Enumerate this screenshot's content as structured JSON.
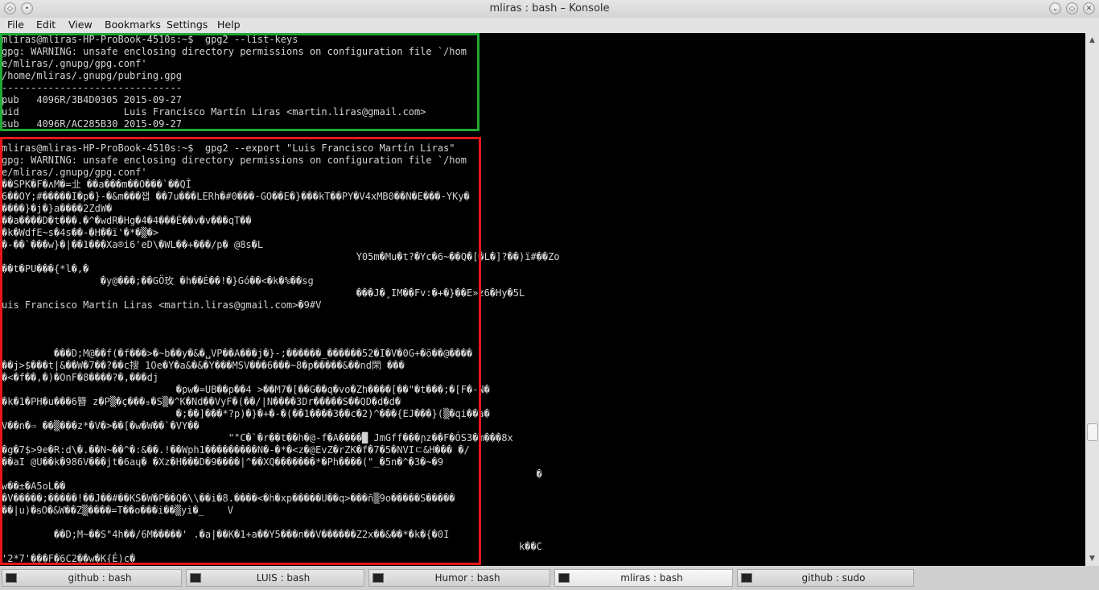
{
  "window": {
    "title": "mliras : bash – Konsole"
  },
  "menu": {
    "items": [
      "File",
      "Edit",
      "View",
      "Bookmarks",
      "Settings",
      "Help"
    ]
  },
  "terminal": {
    "lines": [
      "mliras@mliras-HP-ProBook-4510s:~$  gpg2 --list-keys",
      "gpg: WARNING: unsafe enclosing directory permissions on configuration file `/hom",
      "e/mliras/.gnupg/gpg.conf'",
      "/home/mliras/.gnupg/pubring.gpg",
      "-------------------------------",
      "pub   4096R/3B4D0305 2015-09-27",
      "uid                  Luis Francisco Martín Liras <martin.liras@gmail.com>",
      "sub   4096R/AC285B30 2015-09-27",
      "",
      "mliras@mliras-HP-ProBook-4510s:~$  gpg2 --export \"Luis Francisco Martín Liras\"",
      "gpg: WARNING: unsafe enclosing directory permissions on configuration file `/hom",
      "e/mliras/.gnupg/gpg.conf'",
      "��SPK�F�ʌM�=㐀 ��a���m��O���`��QÎ",
      "6��OY;#�����I�p�}-�&m���잽 ��7u���LERh�#0���-GO��E�}���kT��PY�V4xMB0��N�E���-YKy�",
      "����}�j�}a����2ZdW�",
      "��a����D�t���.�^�wdR�Hg�4�4���É��v�v���qT��",
      "�k�WdfE~s�4s��-�H��ï'�*�▒�>",
      "�-��`���w}�|��1���Xa®i6'eD\\�WL��+���/p� @8s�L",
      "                                                             Y05m�Mu�t?�Yc�6~��Q�[�L�]?��)ï#��Zo",
      "��t�PU���{*l�,�",
      "                 �y@���;��GÖ玫 �h��É��!�}Gó��<�k�%��sg",
      "                                                             ���J�¸IM��Fv:�+�}��E»z6�Hy�5L",
      "uis Francisco Martín Liras <martin.liras@gmail.com>�9#V",
      "",
      "",
      "",
      "         ���D;M@��f(�f���>�~b��y�&�␣VP��A���j�}-;������_������52�I�V�0G+�õ��@����",
      "��j>$���t|&��W�7��?��c搜 1Oe�Y�a&�&�Y���MSV���6���~8�p�����&��nd閑 ���",
      "�<�f��,�)�OnF�8����?�,���dj",
      "                              �pw�=UB��p��4 >��M7�[��G��q�vo�Zh����[��\"�t���;�[F�-N�",
      "�k�1�PH�u���6簪 z�P▒�ç���₉�S▒�^K�Nd��VyF�(��/|N����3Dr�����S��QD�d�d�",
      "                              �;��]���*?p)�}�+�-�(��1����3��c�2)^���{EJ���}(▒�qi��a�",
      "V��n�⇨ ��▒���z*�V�>��[�w�W��`�VY��",
      "                                       \"\"C�`�r��t��h�@-f�A����█ JmGff���ɲz��F�ÓS3�m���8x",
      "�g�7$>9e�R:d\\�.��N~��^�:&��.!��Wph1���������N�-�*�<z�@EvZ�rZK�f�7�5�NVIㄷ&H��� �/",
      "��aI @U��k�986V���jt�6aɥ� �Xz�H���D�9����|^��XQ�������*�Ph����(\"_�5n�^�3�~�9",
      "                                                                                            �",
      "w��±�A5oL��",
      "�V�����;�����!��J��#��KS�W�P��Q�\\\\��i�8.����<�h�xp�����U��q>���ñ▒9o�����S�����",
      "��|u)�ꞩO�&W��Z▒����=T��o���i��▒yi�_    V",
      "",
      "         ��D;M~��S\"4h��/6M�����' .�a|��K�1+a��Y5���n��V������Z2x��&��*�k�{�0I",
      "                                                                                         k��C",
      "'2*7'���F�6C2��w�K{É)c�"
    ]
  },
  "scrollbar": {
    "up_icon": "chevron-up-icon",
    "down_icon": "chevron-down-icon"
  },
  "tabs": [
    {
      "label": "github : bash",
      "active": false
    },
    {
      "label": "LUIS : bash",
      "active": false
    },
    {
      "label": "Humor : bash",
      "active": false
    },
    {
      "label": "mliras : bash",
      "active": true
    },
    {
      "label": "github : sudo",
      "active": false
    }
  ]
}
